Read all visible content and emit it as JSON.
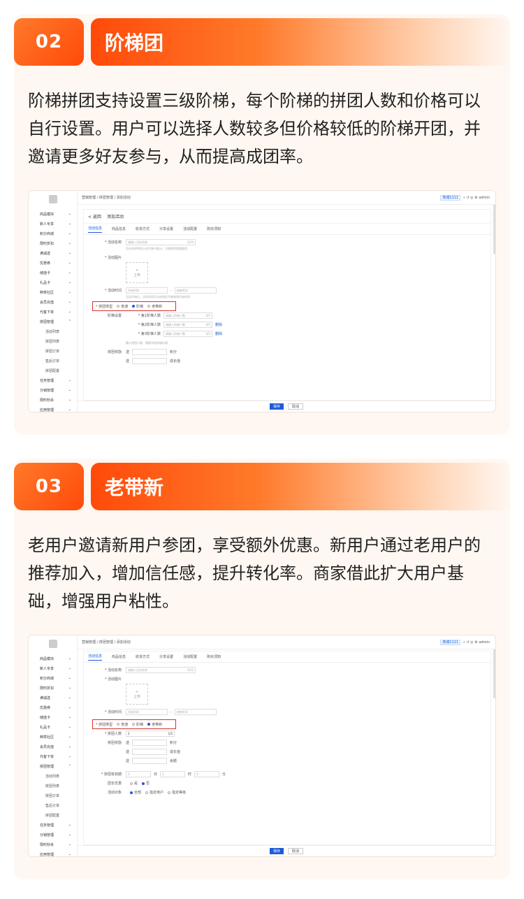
{
  "colors": {
    "accent": "#ff5a14",
    "primary_blue": "#1e5bd8",
    "highlight_red": "#d9302c"
  },
  "sections": [
    {
      "number": "02",
      "title": "阶梯团",
      "description": "阶梯拼团支持设置三级阶梯，每个阶梯的拼团人数和价格可以自行设置。用户可以选择人数较多但价格较低的阶梯开团，并邀请更多好友参与，从而提高成团率。",
      "screenshot": {
        "breadcrumb": "营销管理 / 拼团管理 / 添加活动",
        "top_tag": "商城1111",
        "user": "admin",
        "back_label": "< 返回",
        "page_title": "添加活动",
        "tabs": [
          "活动信息",
          "商品信息",
          "收货方式",
          "分享设置",
          "活动配置",
          "购买须知"
        ],
        "fields": {
          "name_label": "* 活动名称",
          "name_placeholder": "请输入活动名称",
          "name_counter": "0/20",
          "name_hint": "活动名称将显示在列表中展示，方便商家管理使用",
          "image_label": "* 活动图片",
          "upload": "上传",
          "time_label": "* 活动时间",
          "time_start": "开始时间",
          "time_end": "结束时间",
          "time_hint": "活动开始后，活动时间可以修改但不能修改开始时间",
          "type_label": "* 拼团类型",
          "type_opts": [
            "普通",
            "阶梯",
            "老带新"
          ],
          "tier_label": "阶梯设置",
          "tier1": "* 第1阶梯人数",
          "tier2": "* 第2阶梯人数",
          "tier3": "* 第3阶梯人数",
          "tier_ph": "请输入阶梯人数",
          "tier_counter": "0/5",
          "delete": "删除",
          "reward_hint": "最小拼团人数，需要添加阶梯价格",
          "reward_label": "拼团奖励",
          "send": "送",
          "unit_points": "积分",
          "unit_growth": "成长值"
        },
        "save": "保存",
        "cancel": "取消"
      }
    },
    {
      "number": "03",
      "title": "老带新",
      "description": "老用户邀请新用户参团，享受额外优惠。新用户通过老用户的推荐加入，增加信任感，提升转化率。商家借此扩大用户基础，增强用户粘性。",
      "screenshot": {
        "breadcrumb": "营销管理 / 拼团管理 / 添加活动",
        "top_tag": "商城1111",
        "user": "admin",
        "tabs": [
          "活动信息",
          "商品信息",
          "收货方式",
          "分享设置",
          "活动配置",
          "购买须知"
        ],
        "fields": {
          "name_label": "* 活动名称",
          "name_placeholder": "请输入活动名称",
          "name_counter": "0/20",
          "image_label": "* 活动图片",
          "upload": "上传",
          "time_label": "* 活动时间",
          "time_start": "开始时间",
          "time_end": "结束时间",
          "type_label": "* 拼团类型",
          "type_opts": [
            "普通",
            "阶梯",
            "老带新"
          ],
          "people_label": "* 拼团人数",
          "people_value": "2",
          "people_counter": "1/5",
          "reward_label": "拼团奖励",
          "send": "送",
          "unit_points": "积分",
          "unit_growth": "成长值",
          "unit_balance": "余额",
          "valid_label": "* 拼团有效期",
          "day": "日",
          "hour": "时",
          "minute": "分",
          "discount_label": "团长优惠",
          "no": "是",
          "yes": "否",
          "target_label": "活动对象",
          "target_opts": [
            "全部",
            "指定用户",
            "指定等级"
          ]
        },
        "save": "保存",
        "cancel": "取消"
      }
    }
  ],
  "sidebar": [
    "商品模块",
    "新人专享",
    "积分商城",
    "限时折扣",
    "满减送",
    "优惠券",
    "储值卡",
    "礼品卡",
    "种草社区",
    "会员充值",
    "代客下单",
    "拼团管理",
    "活动列表",
    "拼团列表",
    "拼团订单",
    "售后订单",
    "拼团配置",
    "任务管理",
    "分销管理",
    "限时秒杀",
    "应用管理"
  ]
}
